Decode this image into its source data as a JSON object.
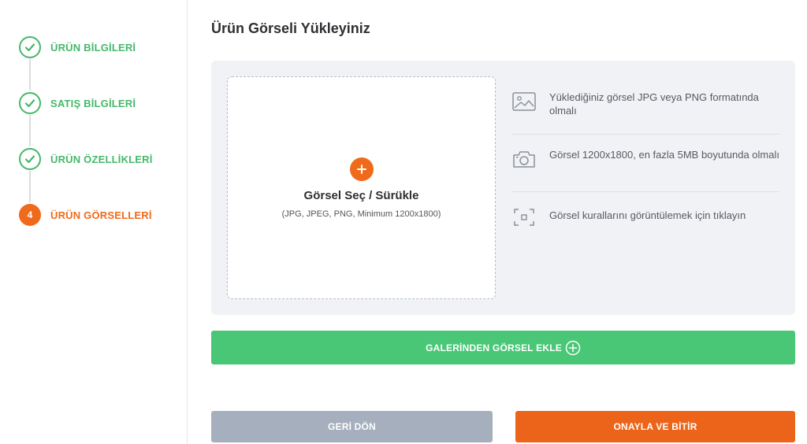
{
  "steps": [
    {
      "label": "ÜRÜN BİLGİLERİ",
      "state": "done",
      "icon": "check-icon"
    },
    {
      "label": "SATIŞ BİLGİLERİ",
      "state": "done",
      "icon": "check-icon"
    },
    {
      "label": "ÜRÜN ÖZELLİKLERİ",
      "state": "done",
      "icon": "check-icon"
    },
    {
      "label": "ÜRÜN GÖRSELLERİ",
      "state": "active",
      "number": "4"
    }
  ],
  "page_title": "Ürün Görseli Yükleyiniz",
  "dropzone": {
    "title": "Görsel Seç / Sürükle",
    "subtitle": "(JPG, JPEG, PNG, Minimum 1200x1800)",
    "icon": "plus-icon"
  },
  "info": [
    {
      "icon": "image-icon",
      "text": "Yüklediğiniz görsel JPG veya PNG formatında olmalı"
    },
    {
      "icon": "camera-icon",
      "text": "Görsel 1200x1800, en fazla 5MB boyutunda olmalı"
    },
    {
      "icon": "frame-icon",
      "text": "Görsel kurallarını görüntülemek için tıklayın"
    }
  ],
  "buttons": {
    "gallery": "GALERİNDEN GÖRSEL EKLE",
    "back": "GERİ DÖN",
    "confirm": "ONAYLA VE BİTİR"
  },
  "colors": {
    "success": "#45b86a",
    "accent": "#f06a1b",
    "gallery_button": "#49c776",
    "back_button": "#a5afbd",
    "panel_bg": "#f1f2f5"
  }
}
